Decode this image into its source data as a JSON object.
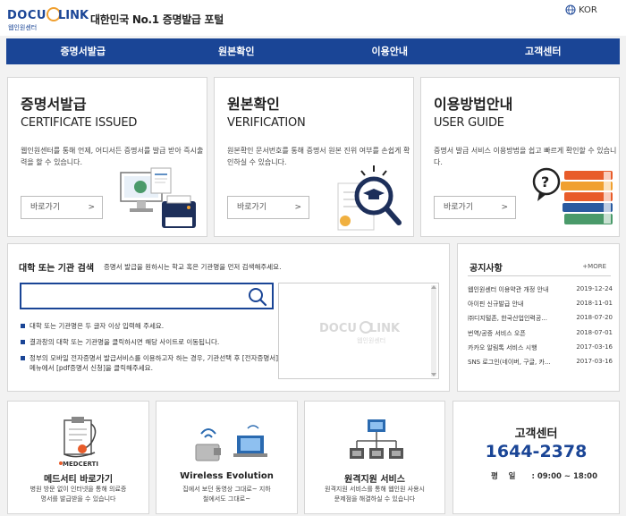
{
  "header": {
    "logo_text": "DOCU LINK",
    "logo_sub": "웹인원센터",
    "slogan": "대한민국 No.1 증명발급 포털",
    "language": "KOR"
  },
  "nav": {
    "items": [
      "증명서발급",
      "원본확인",
      "이용안내",
      "고객센터"
    ]
  },
  "cards": [
    {
      "title": "증명서발급",
      "subtitle": "CERTIFICATE ISSUED",
      "description": "웹인원센터를 통해 언제, 어디서든 증명서를 발급 받아 즉시출력을 할 수 있습니다.",
      "button": "바로가기",
      "arrow": ">"
    },
    {
      "title": "원본확인",
      "subtitle": "VERIFICATION",
      "description": "원본확인 문서번호를 통해 증명서 원본 진위 여부를 손쉽게 확인하실 수 있습니다.",
      "button": "바로가기",
      "arrow": ">"
    },
    {
      "title": "이용방법안내",
      "subtitle": "USER GUIDE",
      "description": "증명서 발급 서비스 이용방법을 쉽고 빠르게 확인할 수 있습니다.",
      "button": "바로가기",
      "arrow": ">"
    }
  ],
  "search": {
    "title": "대학 또는 기관 검색",
    "hint": "증명서 발급을 원하시는 학교 혹은 기관명을 먼저 검색해주세요.",
    "value": "",
    "placeholder": "",
    "notes": [
      "대학 또는 기관명은 두 글자 이상 입력해 주세요.",
      "결과창의 대학 또는 기관명을 클릭하시면 해당 사이트로 이동됩니다.",
      "정부의 모바일 전자증명서 발급서비스를 이용하고자 하는 경우, 기관선택 후 [전자증명서] 메뉴에서 [pdf증명서 신청]을 클릭해주세요."
    ],
    "preview_logo": "DOCU LINK",
    "preview_logo_sub": "웹인원센터"
  },
  "notice": {
    "title": "공지사항",
    "more": "+MORE",
    "items": [
      {
        "title": "웹인원센터 이용약관 개정 안내",
        "date": "2019-12-24"
      },
      {
        "title": "아이핀 신규발급 안내",
        "date": "2018-11-01"
      },
      {
        "title": "㈜디지털존, 한국산업인력공...",
        "date": "2018-07-20"
      },
      {
        "title": "번역/공증 서비스 오픈",
        "date": "2018-07-01"
      },
      {
        "title": "카카오 알림톡 서비스 시행",
        "date": "2017-03-16"
      },
      {
        "title": "SNS 로그인(네이버, 구글, 카...",
        "date": "2017-03-16"
      }
    ]
  },
  "services": [
    {
      "badge": "MEDCERTI",
      "title": "메드서티 바로가기",
      "description": "병원 방문 없이 인터넷을 통해 의료증명서를 발급받을 수 있습니다"
    },
    {
      "title": "Wireless Evolution",
      "description": "집에서 보던 동영상 그대로~ 지하철에서도 그대로~"
    },
    {
      "title": "원격지원 서비스",
      "description": "원격지원 서비스를 통해 웹인원 사용시 문제점을 해결하실 수 있습니다"
    }
  ],
  "customer_center": {
    "title": "고객센터",
    "phone": "1644-2378",
    "hours_label": "평    일",
    "hours_value": ": 09:00 ~ 18:00"
  },
  "colors": {
    "brand_blue": "#1a4596",
    "accent_orange": "#f0a030",
    "background": "#f2f2f2"
  }
}
